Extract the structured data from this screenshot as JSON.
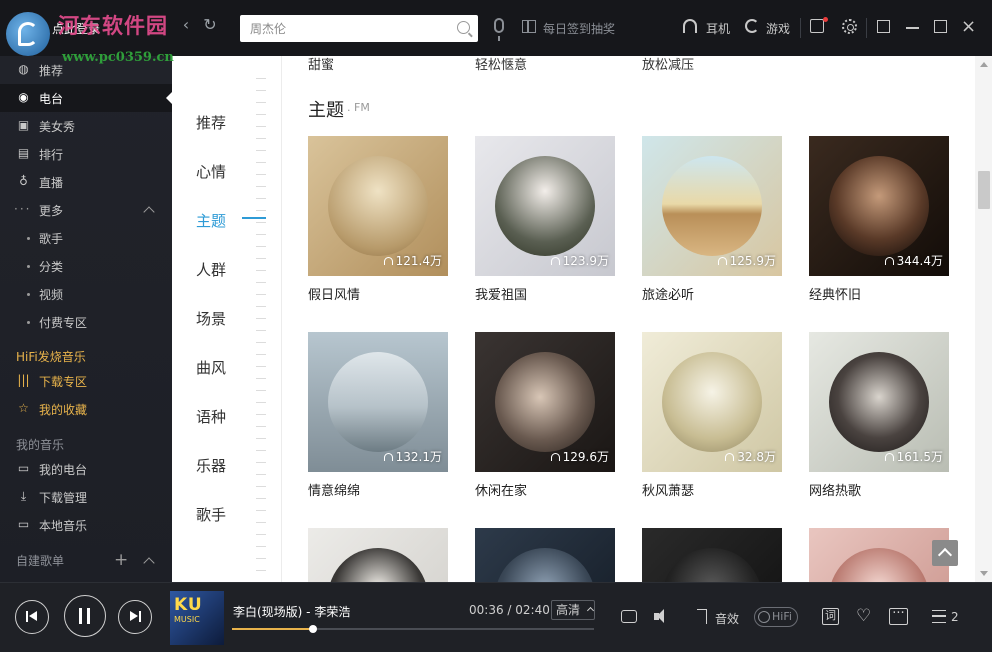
{
  "titlebar": {
    "brand_watermark": "河东软件园",
    "brand_url": "www.pc0359.cn",
    "login_label": "点此登录",
    "back_icon": "chevron-left-icon",
    "refresh_icon": "refresh-icon",
    "search_placeholder": "周杰伦",
    "signin_label": "每日签到抽奖",
    "earphone_label": "耳机",
    "game_label": "游戏"
  },
  "sidebar": {
    "items": [
      {
        "label": "推荐",
        "icon": "recommend-icon"
      },
      {
        "label": "电台",
        "icon": "radio-icon",
        "active": true
      },
      {
        "label": "美女秀",
        "icon": "tv-icon"
      },
      {
        "label": "排行",
        "icon": "chart-icon"
      },
      {
        "label": "直播",
        "icon": "mic-icon"
      },
      {
        "label": "更多",
        "icon": "more-icon"
      }
    ],
    "more_items": [
      "歌手",
      "分类",
      "视频",
      "付费专区"
    ],
    "hifi_section": "HiFi发烧音乐",
    "hifi_items": [
      "下载专区",
      "我的收藏"
    ],
    "my_music_section": "我的音乐",
    "my_music_items": [
      "我的电台",
      "下载管理",
      "本地音乐"
    ],
    "playlist_section": "自建歌单"
  },
  "main": {
    "categories": [
      "推荐",
      "心情",
      "主题",
      "人群",
      "场景",
      "曲风",
      "语种",
      "乐器",
      "歌手"
    ],
    "active_category": "主题",
    "top_partial": [
      "甜蜜",
      "轻松惬意",
      "放松减压"
    ],
    "section_title": "主题",
    "section_subtitle": ". FM",
    "cards": [
      {
        "title": "假日风情",
        "count": "121.4万"
      },
      {
        "title": "我爱祖国",
        "count": "123.9万"
      },
      {
        "title": "旅途必听",
        "count": "125.9万"
      },
      {
        "title": "经典怀旧",
        "count": "344.4万"
      },
      {
        "title": "情意绵绵",
        "count": "132.1万"
      },
      {
        "title": "休闲在家",
        "count": "129.6万"
      },
      {
        "title": "秋风萧瑟",
        "count": "32.8万"
      },
      {
        "title": "网络热歌",
        "count": "161.5万"
      }
    ]
  },
  "player": {
    "album_text": "KU",
    "album_subtext": "MUSIC",
    "song": "李白(现场版) - 李荣浩",
    "time": "00:36 / 02:40",
    "progress": 0.225,
    "quality": "高清",
    "effect_label": "音效",
    "hifi_label": "HiFi",
    "lyric_label": "词",
    "playlist_count": "2"
  },
  "colors": {
    "accent": "#2e9bd6",
    "gold": "#e8b34b",
    "sidebar_bg": "#1f2126",
    "content_bg": "#ffffff"
  }
}
